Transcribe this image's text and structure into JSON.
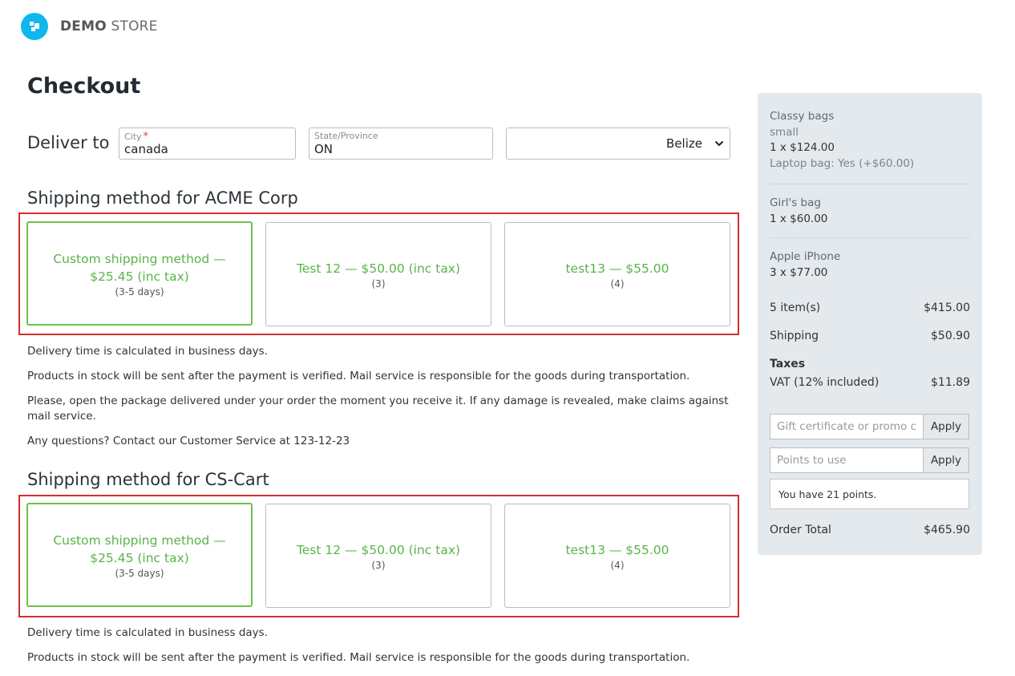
{
  "header": {
    "logo_bold": "DEMO",
    "logo_light": " STORE",
    "logo_color": "#10b7ef"
  },
  "page": {
    "title": "Checkout"
  },
  "deliver": {
    "label": "Deliver to",
    "city_label": "City",
    "city_required": "*",
    "city_value": "canada",
    "state_label": "State/Province",
    "state_value": "ON",
    "country_value": "Belize"
  },
  "sections": [
    {
      "title": "Shipping method for ACME Corp",
      "options": [
        {
          "name": "Custom shipping method — $25.45 (inc tax)",
          "desc": "(3-5 days)",
          "selected": true
        },
        {
          "name": "Test 12 — $50.00 (inc tax)",
          "desc": "(3)",
          "selected": false
        },
        {
          "name": "test13 — $55.00",
          "desc": "(4)",
          "selected": false
        }
      ],
      "info": [
        "Delivery time is calculated in business days.",
        "Products in stock will be sent after the payment is verified. Mail service is responsible for the goods during transportation.",
        "Please, open the package delivered under your order the moment you receive it. If any damage is revealed, make claims against mail service.",
        "Any questions? Contact our Customer Service at 123-12-23"
      ]
    },
    {
      "title": "Shipping method for CS-Cart",
      "options": [
        {
          "name": "Custom shipping method — $25.45 (inc tax)",
          "desc": "(3-5 days)",
          "selected": true
        },
        {
          "name": "Test 12 — $50.00 (inc tax)",
          "desc": "(3)",
          "selected": false
        },
        {
          "name": "test13 — $55.00",
          "desc": "(4)",
          "selected": false
        }
      ],
      "info": [
        "Delivery time is calculated in business days.",
        "Products in stock will be sent after the payment is verified. Mail service is responsible for the goods during transportation."
      ]
    }
  ],
  "summary": {
    "products": [
      {
        "name": "Classy bags",
        "option": "small",
        "qty": "1 x $124.00",
        "addon": "Laptop bag: Yes (+$60.00)"
      },
      {
        "name": "Girl's bag",
        "qty": "1 x $60.00"
      },
      {
        "name": "Apple iPhone",
        "qty": "3 x $77.00"
      }
    ],
    "items_label": "5 item(s)",
    "items_value": "$415.00",
    "shipping_label": "Shipping",
    "shipping_value": "$50.90",
    "taxes_label": "Taxes",
    "vat_label": "VAT (12% included)",
    "vat_value": "$11.89",
    "promo_placeholder": "Gift certificate or promo code",
    "promo_button": "Apply",
    "points_placeholder": "Points to use",
    "points_button": "Apply",
    "points_note": "You have 21 points.",
    "total_label": "Order Total",
    "total_value": "$465.90"
  },
  "colors": {
    "selected_border": "#6cc24a",
    "option_text": "#5ab34a",
    "highlight": "#d32f2f",
    "sidebar_bg": "#e4e9ee"
  }
}
